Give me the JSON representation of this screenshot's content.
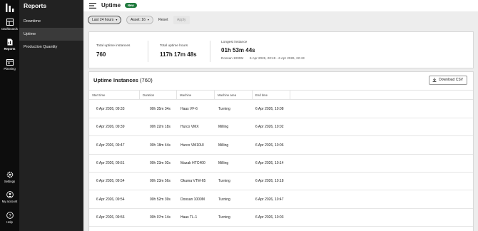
{
  "rail": {
    "items": [
      {
        "label": "Dashboards",
        "icon": "dashboards-icon"
      },
      {
        "label": "Reports",
        "icon": "reports-icon"
      },
      {
        "label": "Planning",
        "icon": "planning-icon"
      }
    ],
    "bottom": [
      {
        "label": "Settings",
        "icon": "gear-icon"
      },
      {
        "label": "My account",
        "icon": "user-icon"
      },
      {
        "label": "Help",
        "icon": "help-icon"
      }
    ]
  },
  "subnav": {
    "title": "Reports",
    "items": [
      {
        "label": "Downtime"
      },
      {
        "label": "Uptime"
      },
      {
        "label": "Production Quantity"
      }
    ]
  },
  "header": {
    "title": "Uptime",
    "badge": "New"
  },
  "filters": {
    "time_range": "Last 24 hours",
    "asset": "Asset: 16",
    "reset": "Reset",
    "apply": "Apply"
  },
  "summary": {
    "total_instances_label": "Total uptime instances",
    "total_instances_value": "760",
    "total_hours_label": "Total uptime hours",
    "total_hours_value": "117h 17m 48s",
    "longest_label": "Longest instance",
    "longest_value": "01h 53m 44s",
    "longest_machine": "Doosan 1000M",
    "longest_range": "6 Apr 2026, 20:49 - 6 Apr 2026, 22:43"
  },
  "table": {
    "title": "Uptime Instances",
    "count": "(760)",
    "download": "Download CSV",
    "columns": [
      "Start time",
      "Duration",
      "Machine",
      "Machine area",
      "End time"
    ],
    "rows": [
      [
        "6 Apr 2026, 09:33",
        "00h 35m 34s",
        "Haas VF-6",
        "Turning",
        "6 Apr 2026, 10:08"
      ],
      [
        "6 Apr 2026, 09:39",
        "00h 22m 18s",
        "Hurco VMX",
        "Milling",
        "6 Apr 2026, 10:02"
      ],
      [
        "6 Apr 2026, 09:47",
        "00h 18m 44s",
        "Hurco VM10UI",
        "Milling",
        "6 Apr 2026, 10:06"
      ],
      [
        "6 Apr 2026, 09:51",
        "00h 23m 02s",
        "Mazak HTC400",
        "Milling",
        "6 Apr 2026, 10:14"
      ],
      [
        "6 Apr 2026, 09:54",
        "00h 23m 56s",
        "Okuma VTM-65",
        "Turning",
        "6 Apr 2026, 10:18"
      ],
      [
        "6 Apr 2026, 09:54",
        "00h 52m 39s",
        "Doosan 1000M",
        "Turning",
        "6 Apr 2026, 10:47"
      ],
      [
        "6 Apr 2026, 09:56",
        "00h 07m 14s",
        "Haas TL-1",
        "Turning",
        "6 Apr 2026, 10:03"
      ]
    ]
  },
  "colors": {
    "rail_bg": "#0d0d0d",
    "subnav_bg": "#222222",
    "subnav_active": "#3a3a3a",
    "badge_bg": "#1f7a3d"
  }
}
